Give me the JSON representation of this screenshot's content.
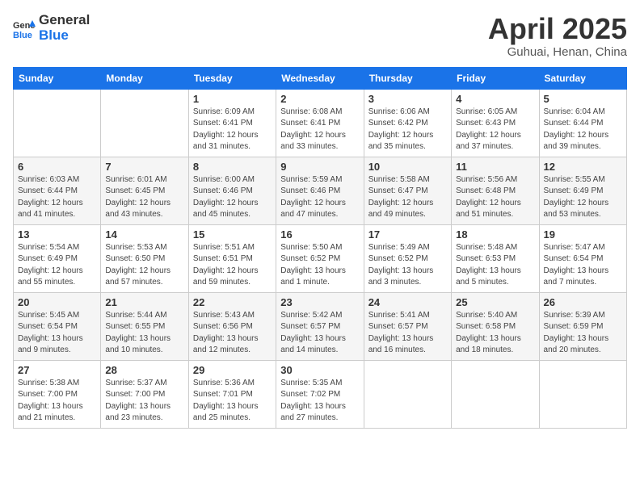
{
  "header": {
    "logo_general": "General",
    "logo_blue": "Blue",
    "title": "April 2025",
    "subtitle": "Guhuai, Henan, China"
  },
  "weekdays": [
    "Sunday",
    "Monday",
    "Tuesday",
    "Wednesday",
    "Thursday",
    "Friday",
    "Saturday"
  ],
  "weeks": [
    [
      {
        "day": "",
        "info": ""
      },
      {
        "day": "",
        "info": ""
      },
      {
        "day": "1",
        "info": "Sunrise: 6:09 AM\nSunset: 6:41 PM\nDaylight: 12 hours\nand 31 minutes."
      },
      {
        "day": "2",
        "info": "Sunrise: 6:08 AM\nSunset: 6:41 PM\nDaylight: 12 hours\nand 33 minutes."
      },
      {
        "day": "3",
        "info": "Sunrise: 6:06 AM\nSunset: 6:42 PM\nDaylight: 12 hours\nand 35 minutes."
      },
      {
        "day": "4",
        "info": "Sunrise: 6:05 AM\nSunset: 6:43 PM\nDaylight: 12 hours\nand 37 minutes."
      },
      {
        "day": "5",
        "info": "Sunrise: 6:04 AM\nSunset: 6:44 PM\nDaylight: 12 hours\nand 39 minutes."
      }
    ],
    [
      {
        "day": "6",
        "info": "Sunrise: 6:03 AM\nSunset: 6:44 PM\nDaylight: 12 hours\nand 41 minutes."
      },
      {
        "day": "7",
        "info": "Sunrise: 6:01 AM\nSunset: 6:45 PM\nDaylight: 12 hours\nand 43 minutes."
      },
      {
        "day": "8",
        "info": "Sunrise: 6:00 AM\nSunset: 6:46 PM\nDaylight: 12 hours\nand 45 minutes."
      },
      {
        "day": "9",
        "info": "Sunrise: 5:59 AM\nSunset: 6:46 PM\nDaylight: 12 hours\nand 47 minutes."
      },
      {
        "day": "10",
        "info": "Sunrise: 5:58 AM\nSunset: 6:47 PM\nDaylight: 12 hours\nand 49 minutes."
      },
      {
        "day": "11",
        "info": "Sunrise: 5:56 AM\nSunset: 6:48 PM\nDaylight: 12 hours\nand 51 minutes."
      },
      {
        "day": "12",
        "info": "Sunrise: 5:55 AM\nSunset: 6:49 PM\nDaylight: 12 hours\nand 53 minutes."
      }
    ],
    [
      {
        "day": "13",
        "info": "Sunrise: 5:54 AM\nSunset: 6:49 PM\nDaylight: 12 hours\nand 55 minutes."
      },
      {
        "day": "14",
        "info": "Sunrise: 5:53 AM\nSunset: 6:50 PM\nDaylight: 12 hours\nand 57 minutes."
      },
      {
        "day": "15",
        "info": "Sunrise: 5:51 AM\nSunset: 6:51 PM\nDaylight: 12 hours\nand 59 minutes."
      },
      {
        "day": "16",
        "info": "Sunrise: 5:50 AM\nSunset: 6:52 PM\nDaylight: 13 hours\nand 1 minute."
      },
      {
        "day": "17",
        "info": "Sunrise: 5:49 AM\nSunset: 6:52 PM\nDaylight: 13 hours\nand 3 minutes."
      },
      {
        "day": "18",
        "info": "Sunrise: 5:48 AM\nSunset: 6:53 PM\nDaylight: 13 hours\nand 5 minutes."
      },
      {
        "day": "19",
        "info": "Sunrise: 5:47 AM\nSunset: 6:54 PM\nDaylight: 13 hours\nand 7 minutes."
      }
    ],
    [
      {
        "day": "20",
        "info": "Sunrise: 5:45 AM\nSunset: 6:54 PM\nDaylight: 13 hours\nand 9 minutes."
      },
      {
        "day": "21",
        "info": "Sunrise: 5:44 AM\nSunset: 6:55 PM\nDaylight: 13 hours\nand 10 minutes."
      },
      {
        "day": "22",
        "info": "Sunrise: 5:43 AM\nSunset: 6:56 PM\nDaylight: 13 hours\nand 12 minutes."
      },
      {
        "day": "23",
        "info": "Sunrise: 5:42 AM\nSunset: 6:57 PM\nDaylight: 13 hours\nand 14 minutes."
      },
      {
        "day": "24",
        "info": "Sunrise: 5:41 AM\nSunset: 6:57 PM\nDaylight: 13 hours\nand 16 minutes."
      },
      {
        "day": "25",
        "info": "Sunrise: 5:40 AM\nSunset: 6:58 PM\nDaylight: 13 hours\nand 18 minutes."
      },
      {
        "day": "26",
        "info": "Sunrise: 5:39 AM\nSunset: 6:59 PM\nDaylight: 13 hours\nand 20 minutes."
      }
    ],
    [
      {
        "day": "27",
        "info": "Sunrise: 5:38 AM\nSunset: 7:00 PM\nDaylight: 13 hours\nand 21 minutes."
      },
      {
        "day": "28",
        "info": "Sunrise: 5:37 AM\nSunset: 7:00 PM\nDaylight: 13 hours\nand 23 minutes."
      },
      {
        "day": "29",
        "info": "Sunrise: 5:36 AM\nSunset: 7:01 PM\nDaylight: 13 hours\nand 25 minutes."
      },
      {
        "day": "30",
        "info": "Sunrise: 5:35 AM\nSunset: 7:02 PM\nDaylight: 13 hours\nand 27 minutes."
      },
      {
        "day": "",
        "info": ""
      },
      {
        "day": "",
        "info": ""
      },
      {
        "day": "",
        "info": ""
      }
    ]
  ]
}
